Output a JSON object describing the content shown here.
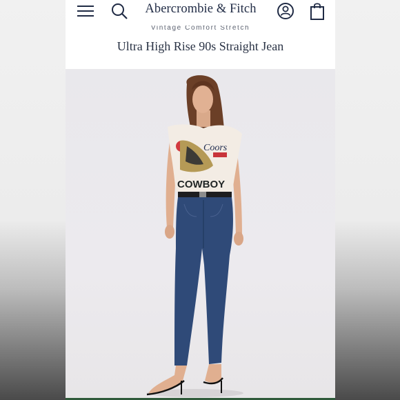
{
  "header": {
    "brand": "Abercrombie & Fitch",
    "icons": [
      "menu-icon",
      "search-icon",
      "account-icon",
      "shopping-bag-icon"
    ]
  },
  "product": {
    "subtitle": "Vintage Comfort Stretch",
    "title": "Ultra High Rise 90s Straight Jean"
  },
  "colors": {
    "text_primary": "#1f2a44",
    "denim": "#2f4a78",
    "shirt": "#f3ece4"
  }
}
